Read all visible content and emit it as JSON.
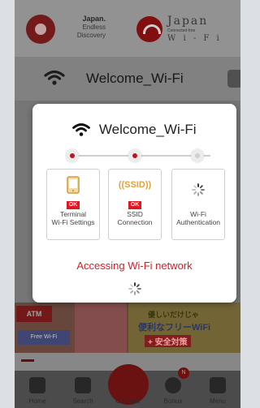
{
  "header": {
    "logo_left": {
      "line1": "Japan.",
      "line2": "Endless",
      "line3": "Discovery"
    },
    "logo_right": {
      "title": "Japan",
      "small": "Connected-free",
      "sub": "W i - F i"
    }
  },
  "network": {
    "ssid": "Welcome_Wi-Fi"
  },
  "dialog": {
    "title": "Welcome_Wi-Fi",
    "steps": [
      {
        "label_line1": "Terminal",
        "label_line2": "Wi-Fi Settings",
        "status": "OK",
        "state": "done",
        "icon": "phone-icon"
      },
      {
        "label_line1": "SSID",
        "label_line2": "Connection",
        "status": "OK",
        "state": "done",
        "icon": "ssid-icon"
      },
      {
        "label_line1": "Wi-Fi",
        "label_line2": "Authentication",
        "status": "",
        "state": "in-progress",
        "icon": "spinner-icon"
      }
    ],
    "status_message": "Accessing Wi-Fi network"
  },
  "banner": {
    "atm": "ATM",
    "free_wifi": "Free Wi-Fi",
    "right_line1": "優しいだけじゃ",
    "right_line2": "便利なフリーWiFi",
    "right_line3": "+ 安全対策"
  },
  "tabbar": {
    "tabs": [
      {
        "label": "Home",
        "icon": "home-icon"
      },
      {
        "label": "Search",
        "icon": "search-icon"
      },
      {
        "label": "Connect",
        "icon": "globe-icon"
      },
      {
        "label": "Bonus",
        "icon": "plus-icon",
        "badge": "N"
      },
      {
        "label": "Menu",
        "icon": "menu-icon"
      }
    ]
  },
  "colors": {
    "accent": "#d4202a",
    "ok_badge": "#e01824",
    "dialog_bg": "#ffffff"
  }
}
